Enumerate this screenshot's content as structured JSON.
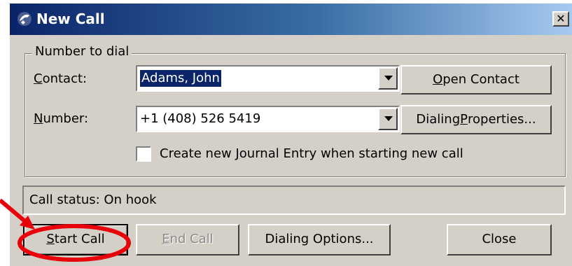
{
  "window": {
    "title": "New Call",
    "close_glyph": "✕"
  },
  "number_group": {
    "legend": "Number to dial",
    "contact_label_mnemonic": "C",
    "contact_label_rest": "ontact:",
    "contact_value": "Adams, John",
    "number_label_mnemonic": "N",
    "number_label_rest": "umber:",
    "number_value": "+1 (408) 526 5419",
    "open_contact_mnemonic": "O",
    "open_contact_rest": "pen Contact",
    "dialing_properties_pre": "Dialing ",
    "dialing_properties_mnemonic": "P",
    "dialing_properties_rest": "roperties...",
    "journal_pre": "Create new ",
    "journal_mnemonic": "J",
    "journal_rest": "ournal Entry when starting new call",
    "journal_checked": false
  },
  "status": {
    "text": "Call status:  On hook"
  },
  "buttons": {
    "start_call_mnemonic": "S",
    "start_call_rest": "tart Call",
    "end_call_mnemonic": "E",
    "end_call_rest": "nd Call",
    "dialing_options": "Dialing Options...",
    "close": "Close"
  },
  "colors": {
    "annotation": "#e8000b",
    "selection": "#0a246a"
  }
}
